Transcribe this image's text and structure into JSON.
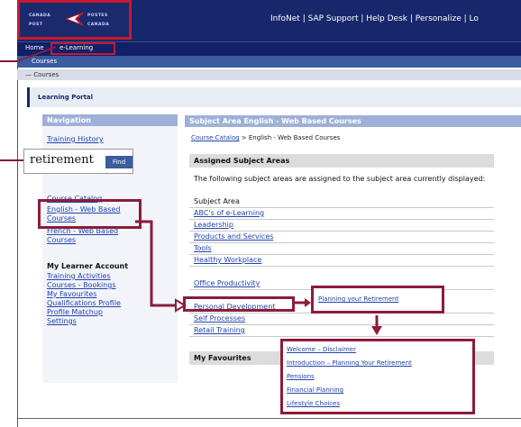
{
  "header": {
    "logo_lines": [
      "CANADA",
      "POST",
      "POSTES",
      "CANADA"
    ],
    "links": "InfoNet | SAP Support | Help Desk | Personalize | Lo"
  },
  "tabs": {
    "home": "Home",
    "elearning": "e-Learning"
  },
  "subnav": {
    "label": "Courses"
  },
  "breadcrumb": {
    "label": "— Courses"
  },
  "portal": {
    "title": "Learning Portal"
  },
  "navigation": {
    "heading": "Navigation",
    "training_history": "Training History",
    "search_value": "retirement",
    "find_label": "Find",
    "course_catalog": "Course Catalog",
    "english_web_based_courses": "English - Web Based Courses",
    "french_web_based_courses": "French - Web Based Courses",
    "my_learner_account": "My Learner Account",
    "learner_links": [
      "Training Activities",
      "Courses - Bookings",
      "My Favourites",
      "Qualifications Profile",
      "Profile Matchup",
      "Settings"
    ]
  },
  "subject_area": {
    "heading": "Subject Area English - Web Based Courses",
    "crumb_link": "Course Catalog",
    "crumb_rest": " > English - Web Based Courses",
    "assigned_title": "Assigned Subject Areas",
    "description": "The following subject areas are assigned to the subject area currently displayed:",
    "list_header": "Subject Area",
    "areas": [
      "ABC's of e-Learning",
      "Leadership",
      "Products and Services",
      "Tools",
      "Healthy Workplace",
      "Office Productivity",
      "Personal Development",
      "Self Processes",
      "Retail Training"
    ],
    "favourites_title": "My Favourites"
  },
  "personal_development_link": "Planning your Retirement",
  "subtopics": [
    "Welcome – Disclaimer",
    "Introduction – Planning Your Retirement",
    "Pensions",
    "Financial Planning",
    "Lifestyle Choices"
  ],
  "colors": {
    "header_navy": "#16286b",
    "highlight_red": "#c8182e",
    "callout_maroon": "#8c1c3a",
    "link_blue": "#2244aa"
  }
}
